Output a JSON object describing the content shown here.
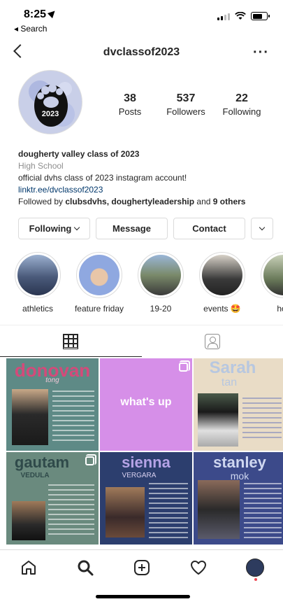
{
  "status_bar": {
    "time": "8:25",
    "back_app": "◂ Search"
  },
  "header": {
    "username": "dvclassof2023",
    "more_icon": "more-horizontal-icon"
  },
  "profile": {
    "avatar_text": "2023",
    "stats": [
      {
        "value": "38",
        "label": "Posts"
      },
      {
        "value": "537",
        "label": "Followers"
      },
      {
        "value": "22",
        "label": "Following"
      }
    ],
    "name": "dougherty valley class of 2023",
    "category": "High School",
    "bio": "official dvhs class of 2023 instagram account!",
    "link": "linktr.ee/dvclassof2023",
    "followed_by_prefix": "Followed by ",
    "followed_by_users": "clubsdvhs, doughertyleadership",
    "followed_by_and": " and ",
    "followed_by_others": "9 others"
  },
  "buttons": {
    "following": "Following",
    "message": "Message",
    "contact": "Contact"
  },
  "highlights": [
    {
      "label": "athletics",
      "color": "#4a5a7a"
    },
    {
      "label": "feature friday",
      "color": "#8fa8e0"
    },
    {
      "label": "19-20",
      "color": "#7a8a6a"
    },
    {
      "label": "events 🤩",
      "color": "#3a3a3a"
    },
    {
      "label": "hoc",
      "color": "#6a7a5a"
    }
  ],
  "posts": [
    {
      "title": "donovan",
      "subtitle": "tong",
      "bg": "#5e8a86",
      "title_color": "#d44a7a",
      "multi": false
    },
    {
      "title": "what's up",
      "subtitle": "",
      "bg": "#d68fe8",
      "title_color": "#ffffff",
      "multi": true
    },
    {
      "title": "Sarah",
      "subtitle": "tan",
      "bg": "#e9dcc6",
      "title_color": "#b7c7e0",
      "multi": false
    },
    {
      "title": "gautam",
      "subtitle": "VEDULA",
      "bg": "#6a8a7e",
      "title_color": "#2f4a4a",
      "multi": true
    },
    {
      "title": "sienna",
      "subtitle": "VERGARA",
      "bg": "#2c3e6e",
      "title_color": "#b5a3e6",
      "multi": false
    },
    {
      "title": "stanley",
      "subtitle": "mok",
      "bg": "#3c4a8a",
      "title_color": "#cfd7f0",
      "multi": false
    }
  ],
  "colors": {
    "link": "#00376b",
    "muted": "#8e8e8e",
    "border": "#dbdbdb",
    "notification_dot": "#ed4956"
  }
}
